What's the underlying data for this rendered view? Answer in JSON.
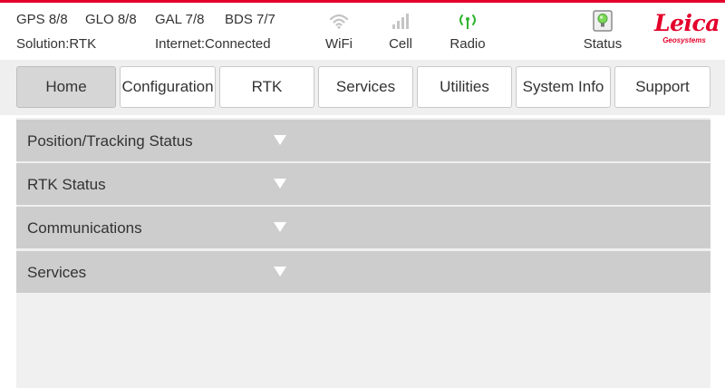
{
  "header": {
    "sat": {
      "gps": "GPS 8/8",
      "glo": "GLO 8/8",
      "gal": "GAL 7/8",
      "bds": "BDS 7/7"
    },
    "solution": "Solution:RTK",
    "internet": "Internet:Connected",
    "indicators": {
      "wifi": {
        "label": "WiFi",
        "icon": "wifi-icon",
        "color": "#bdbdbd"
      },
      "cell": {
        "label": "Cell",
        "icon": "signal-bars-icon",
        "color": "#bdbdbd"
      },
      "radio": {
        "label": "Radio",
        "icon": "radio-antenna-icon",
        "color": "#2fb52f"
      },
      "status": {
        "label": "Status",
        "icon": "status-light-icon",
        "color": "#7ed957"
      }
    },
    "logo": {
      "name": "Leica",
      "subtitle": "Geosystems",
      "color": "#e4002b"
    }
  },
  "nav": {
    "tabs": [
      {
        "label": "Home",
        "active": true
      },
      {
        "label": "Configuration",
        "active": false
      },
      {
        "label": "RTK",
        "active": false
      },
      {
        "label": "Services",
        "active": false
      },
      {
        "label": "Utilities",
        "active": false
      },
      {
        "label": "System Info",
        "active": false
      },
      {
        "label": "Support",
        "active": false
      }
    ]
  },
  "panels": [
    {
      "title": "Position/Tracking Status"
    },
    {
      "title": "RTK Status"
    },
    {
      "title": "Communications"
    },
    {
      "title": "Services"
    }
  ],
  "colors": {
    "accent": "#e4002b",
    "panel_bg": "#cdcdcd",
    "nav_bg": "#efefef",
    "active_tab": "#d6d6d6"
  }
}
